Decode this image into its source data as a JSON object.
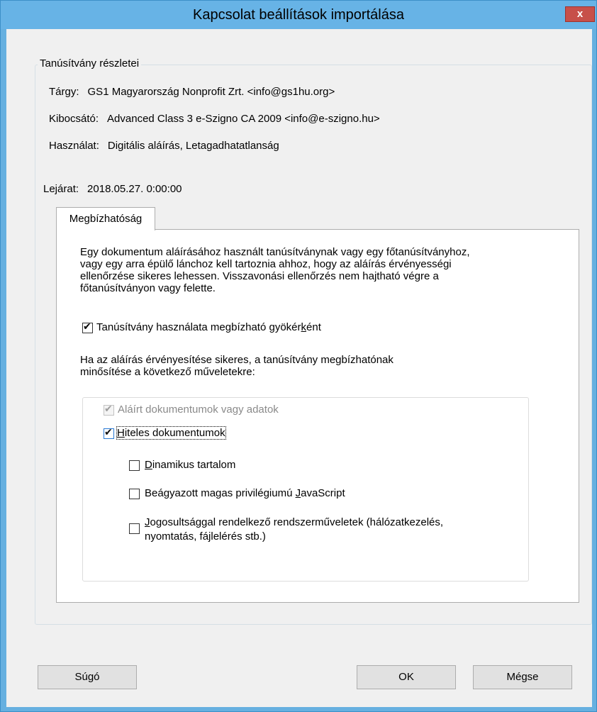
{
  "window": {
    "title": "Kapcsolat beállítások importálása",
    "close_label": "x"
  },
  "cert": {
    "group_title": "Tanúsítvány részletei",
    "subject_label": "Tárgy:",
    "subject_value": "GS1 Magyarország Nonprofit Zrt. <info@gs1hu.org>",
    "issuer_label": "Kibocsátó:",
    "issuer_value": "Advanced Class 3 e-Szigno CA 2009 <info@e-szigno.hu>",
    "usage_label": "Használat:",
    "usage_value": "Digitális aláírás, Letagadhatatlanság",
    "expiry_label": "Lejárat:",
    "expiry_value": "2018.05.27. 0:00:00"
  },
  "tab": {
    "label": "Megbízhatóság"
  },
  "trust": {
    "description": [
      "Egy dokumentum aláírásához használt tanúsítványnak vagy egy főtanúsítványhoz,",
      "vagy egy arra épülő lánchoz kell tartoznia ahhoz, hogy az aláírás érvényességi",
      "ellenőrzése sikeres lehessen. Visszavonási ellenőrzés nem hajtható végre a",
      "főtanúsítványon vagy felette."
    ],
    "root_checkbox": {
      "label_pre": "Tanúsítvány használata megbízható gyökér",
      "label_u": "k",
      "label_post": "ént",
      "checked": true
    },
    "followup": [
      "Ha az aláírás érvényesítése sikeres, a tanúsítvány megbízhatónak",
      "minősítése a következő műveletekre:"
    ],
    "signed_docs": {
      "label": "Aláírt dokumentumok vagy adatok",
      "checked": true,
      "disabled": true
    },
    "certified_docs": {
      "label_u": "H",
      "label_post": "iteles dokumentumok",
      "checked": true
    },
    "dynamic_content": {
      "label_u": "D",
      "label_post": "inamikus tartalom",
      "checked": false
    },
    "embedded_js": {
      "label_pre": "Beágyazott magas privilégiumú ",
      "label_u": "J",
      "label_post": "avaScript",
      "checked": false
    },
    "privileged_ops": {
      "label_u": "J",
      "label_line1": "ogosultsággal rendelkező rendszerműveletek (hálózatkezelés,",
      "label_line2": "nyomtatás, fájlelérés stb.)",
      "checked": false
    }
  },
  "buttons": {
    "help": "Súgó",
    "ok": "OK",
    "cancel": "Mégse"
  }
}
